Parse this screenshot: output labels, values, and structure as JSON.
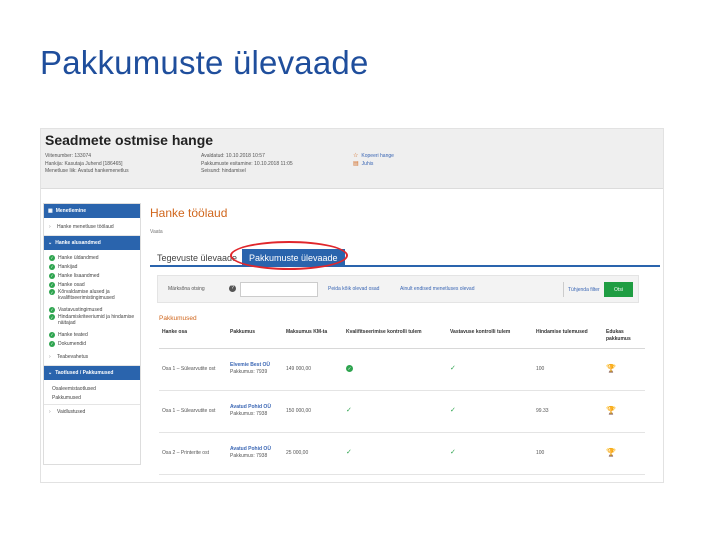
{
  "slide_title": "Pakkumuste ülevaade",
  "header": {
    "title": "Seadmete ostmise hange",
    "col1": [
      "Viitenumber: 133074",
      "Hankija: Kasutaja Juhend [186465]",
      "Menetluse liik: Avatud hankemenetlus"
    ],
    "col2": [
      "Avaldatud: 10.10.2018 10:57",
      "Pakkumuste esitamine: 10.10.2018 11:05",
      "Seisund: hindamisel"
    ],
    "links": [
      {
        "icon": "star-icon",
        "label": "Kopeeri hange"
      },
      {
        "icon": "pdf-icon",
        "label": "Juhis"
      }
    ]
  },
  "sidebar": {
    "top_label": "Menetlemine",
    "item_first": "Hanke menetluse töölaud",
    "section_hanke": "Hanke alusandmed",
    "checked_items": [
      "Hanke üldandmed",
      "Hankijad",
      "Hanke lisaandmed",
      "Hanke osad",
      "Kõrvaldamise alused ja kvalifitseerimistingimused",
      "Vastavustingimused",
      "Hindamiskriteeriumid ja hindamise näitajad",
      "Hanke teated",
      "Dokumendid"
    ],
    "item_teabevahetus": "Teabevahetus",
    "section_taotlused": "Taotlused / Pakkumused",
    "taotlused_items": [
      "Osaleemistaotlused",
      "Pakkumused"
    ],
    "item_vaidlustused": "Vaidlustused"
  },
  "main": {
    "title": "Hanke töölaud",
    "subtitle": "Vaata",
    "tabs": [
      "Tegevuste ülevaade",
      "Pakkumuste ülevaade"
    ],
    "filter": {
      "label": "Märksõna otsing",
      "q": "?",
      "link1": "Peida kõik olevad osad",
      "link2": "Ainult endised menetluses olevad",
      "clear": "Tühjenda filter",
      "button": "Otsi"
    },
    "section": "Pakkumused",
    "columns": [
      "Hanke osa",
      "Pakkumus",
      "Maksumus KM-ta",
      "Kvalifitseerimise kontrolli tulem",
      "Vastavuse kontrolli tulem",
      "Hindamise tulemused",
      "Edukas pakkumus"
    ],
    "rows": [
      {
        "part": "Osa 1 – Sülearvutite ost",
        "company": "Elvemie Best OÜ",
        "offer": "Pakkumus: 7939",
        "price": "149 000,00",
        "qual": "check-circle",
        "conf": "check",
        "score": "100",
        "trophy": "gold"
      },
      {
        "part": "Osa 1 – Sülearvutite ost",
        "company": "Avatud Pohid OÜ",
        "offer": "Pakkumus: 7938",
        "price": "150 000,00",
        "qual": "check",
        "conf": "check",
        "score": "99.33",
        "trophy": "grey"
      },
      {
        "part": "Osa 2 – Printerite ost",
        "company": "Avatud Pohid OÜ",
        "offer": "Pakkumus: 7938",
        "price": "25 000,00",
        "qual": "check",
        "conf": "check",
        "score": "100",
        "trophy": "gold"
      }
    ]
  },
  "colors": {
    "title_blue": "#1f4e9c",
    "accent_blue": "#2a64ad",
    "orange": "#d0661c",
    "green": "#2ea44f",
    "highlight_red": "#e0262b"
  }
}
